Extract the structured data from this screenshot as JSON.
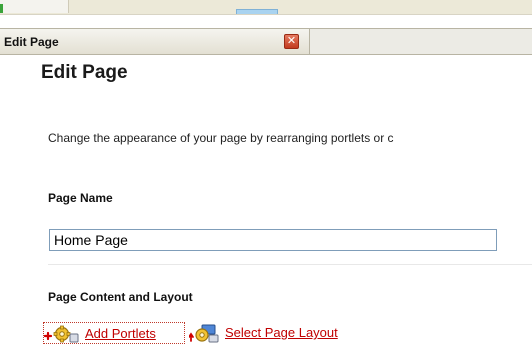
{
  "window": {
    "title": "Edit Page"
  },
  "page": {
    "heading": "Edit Page",
    "description": "Change the appearance of your page by rearranging portlets or c"
  },
  "page_name": {
    "label": "Page Name",
    "value": "Home Page"
  },
  "content_layout": {
    "label": "Page Content and Layout",
    "add_portlets_label": "Add Portlets",
    "select_layout_label": "Select Page Layout"
  },
  "icons": {
    "close": "close-icon",
    "add_portlets": "add-gear-icon",
    "select_layout": "layout-gear-icon"
  },
  "colors": {
    "link": "#c00000",
    "close_button": "#c23b1f",
    "input_border": "#7f9db9"
  }
}
